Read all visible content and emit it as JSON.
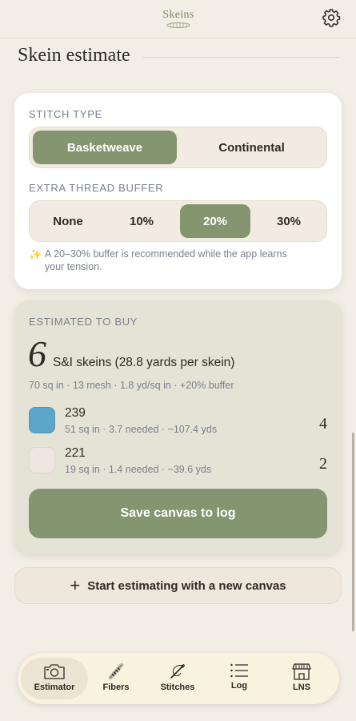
{
  "header": {
    "logo_text": "Skeins",
    "settings_icon": "gear-icon"
  },
  "page_title": "Skein estimate",
  "stitch": {
    "label": "STITCH TYPE",
    "options": [
      "Basketweave",
      "Continental"
    ],
    "selected": "Basketweave"
  },
  "buffer": {
    "label": "EXTRA THREAD BUFFER",
    "options": [
      "None",
      "10%",
      "20%",
      "30%"
    ],
    "selected": "20%",
    "hint_icon": "sparkle-icon",
    "hint": "A 20–30% buffer is recommended while the app learns your tension."
  },
  "estimate": {
    "label": "ESTIMATED TO BUY",
    "count": "6",
    "unit_label": "S&I skeins (28.8 yards per skein)",
    "calc": "70 sq in · 13 mesh · 1.8 yd/sq in · +20% buffer",
    "threads": [
      {
        "code": "239",
        "meta": "51 sq in · 3.7 needed · ~107.4 yds",
        "qty": "4",
        "color": "#5aa5c8"
      },
      {
        "code": "221",
        "meta": "19 sq in · 1.4 needed · ~39.6 yds",
        "qty": "2",
        "color": "#efe6e2"
      }
    ],
    "save_label": "Save canvas to log"
  },
  "new_canvas": {
    "plus": "+",
    "label": "Start estimating with a new canvas"
  },
  "tabs": [
    {
      "label": "Estimator",
      "icon": "camera-icon",
      "active": true
    },
    {
      "label": "Fibers",
      "icon": "fiber-icon",
      "active": false
    },
    {
      "label": "Stitches",
      "icon": "needle-icon",
      "active": false
    },
    {
      "label": "Log",
      "icon": "list-icon",
      "active": false
    },
    {
      "label": "LNS",
      "icon": "store-icon",
      "active": false
    }
  ],
  "colors": {
    "accent": "#849670",
    "background": "#f3eee5",
    "estimate_card": "#e5e3d6"
  }
}
